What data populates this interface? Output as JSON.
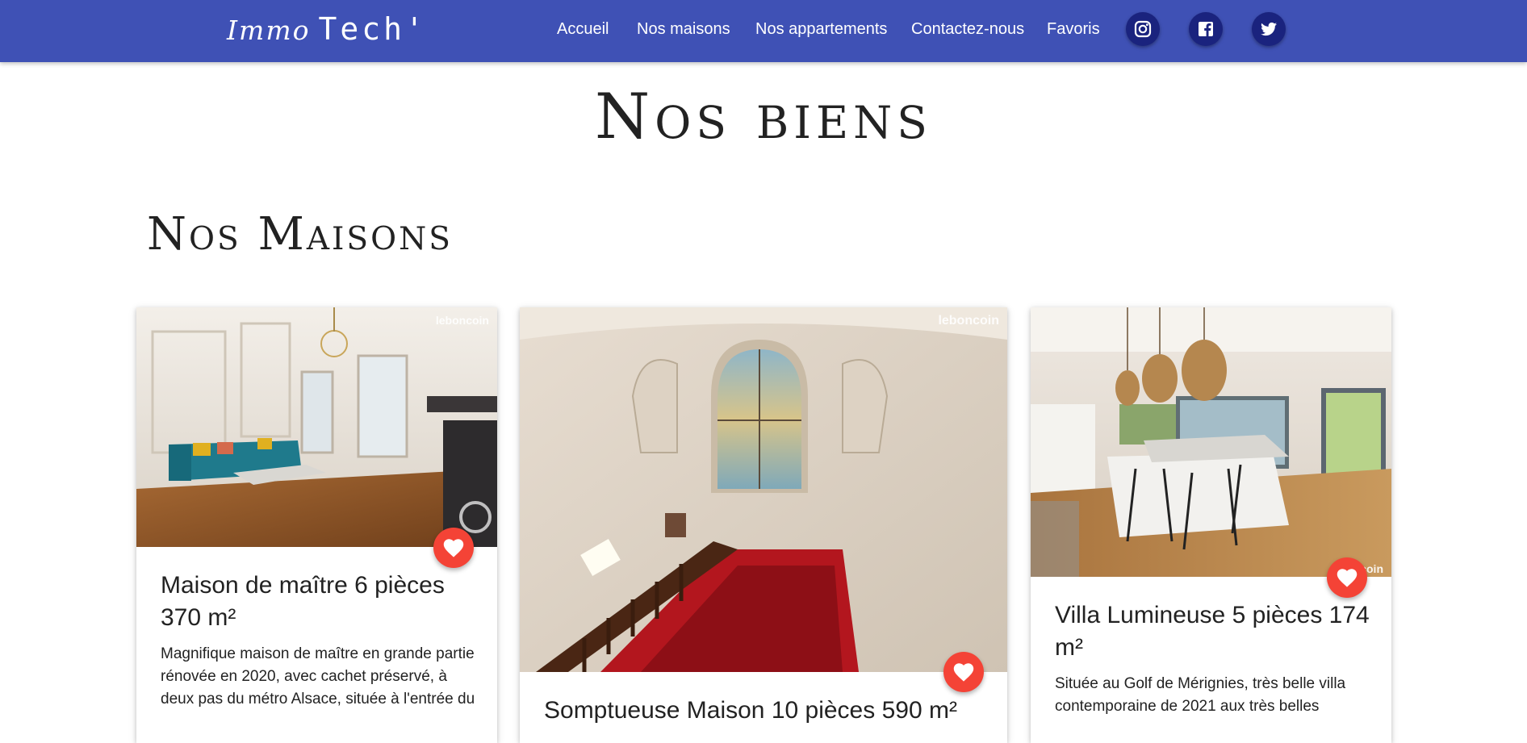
{
  "header": {
    "brand_part1": "Immo",
    "brand_part2": "Tech'",
    "nav": [
      "Accueil",
      "Nos maisons",
      "Nos appartements",
      "Contactez-nous",
      "Favoris"
    ],
    "social_icons": [
      "instagram-icon",
      "facebook-icon",
      "twitter-icon"
    ],
    "background_color": "#3f51b5"
  },
  "main": {
    "page_title": "Nos biens",
    "section_title": "Nos Maisons"
  },
  "cards": [
    {
      "watermark": "leboncoin",
      "title": "Maison de maître 6 pièces 370 m²",
      "description": "Magnifique maison de maître en grande partie rénovée en 2020, avec cachet préservé, à deux pas du métro Alsace, située à l'entrée du"
    },
    {
      "watermark": "leboncoin",
      "title": "Somptueuse Maison 10 pièces 590 m²",
      "description": ""
    },
    {
      "watermark": "coin",
      "title": "Villa Lumineuse 5 pièces 174 m²",
      "description": "Située au Golf de Mérignies, très belle villa contemporaine de 2021 aux très belles"
    }
  ],
  "favorite_button_color": "#f44336"
}
